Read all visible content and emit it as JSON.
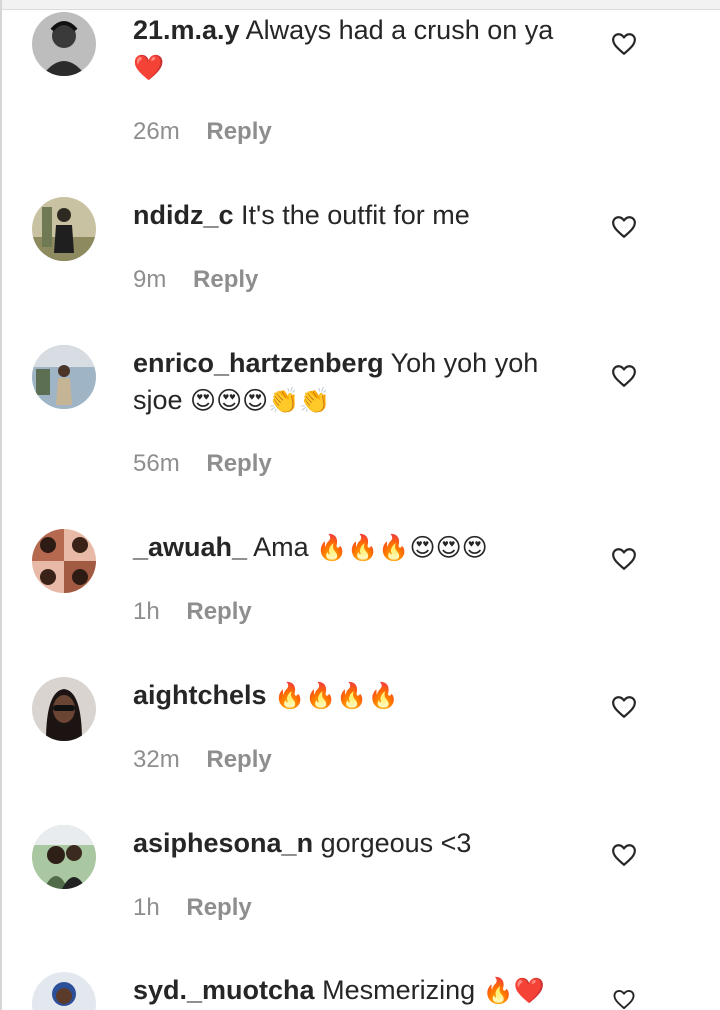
{
  "comments": [
    {
      "username": "21.m.a.y",
      "text": "Always had a crush on ya",
      "emoji": "❤️",
      "time": "26m",
      "reply": "Reply"
    },
    {
      "username": "ndidz_c",
      "text": "It's the outfit for me",
      "emoji": "",
      "time": "9m",
      "reply": "Reply"
    },
    {
      "username": "enrico_hartzenberg",
      "text": "Yoh yoh yoh sjoe",
      "emoji": "😍😍😍👏👏",
      "time": "56m",
      "reply": "Reply"
    },
    {
      "username": "_awuah_",
      "text": "Ama",
      "emoji": "🔥🔥🔥😍😍😍",
      "time": "1h",
      "reply": "Reply"
    },
    {
      "username": "aightchels",
      "text": "",
      "emoji": "🔥🔥🔥🔥",
      "time": "32m",
      "reply": "Reply"
    },
    {
      "username": "asiphesona_n",
      "text": "gorgeous <3",
      "emoji": "",
      "time": "1h",
      "reply": "Reply"
    },
    {
      "username": "syd._muotcha",
      "text": "Mesmerizing",
      "emoji": "🔥❤️",
      "time": "",
      "reply": ""
    }
  ],
  "icons": {
    "like": "heart-outline-icon",
    "avatar": "profile-photo"
  },
  "colors": {
    "text": "#262626",
    "secondary": "#8e8e8e",
    "background": "#ffffff"
  }
}
